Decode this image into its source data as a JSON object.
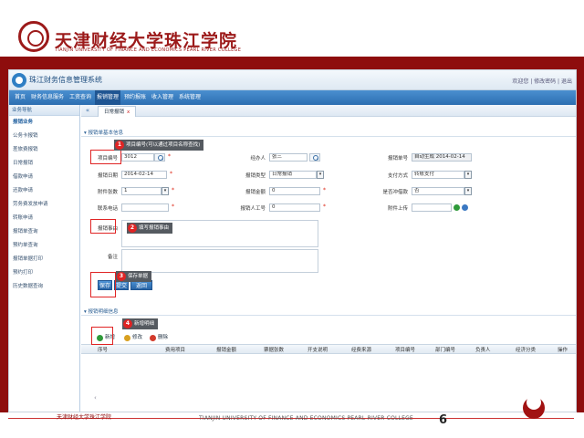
{
  "slide": {
    "university_name_cn": "天津财经大学珠江学院",
    "university_name_en": "TIANJIN UNIVERSITY OF FINANCE AND ECONOMICS PEARL RIVER COLLEGE",
    "footer_left": "天津财经大学珠江学院",
    "footer_center": "TIANJIN UNIVERSITY OF FINANCE AND ECONOMICS PEARL RIVER COLLEGE",
    "page_number": "6",
    "accent_color": "#8e0d0d"
  },
  "app": {
    "title": "珠江财务信息管理系统",
    "top_right": "欢迎您 | 修改密码 | 退出",
    "nav_tabs": [
      "首页",
      "财务信息服务",
      "工资查询",
      "报销管理",
      "预约报账",
      "收入管理",
      "系统管理"
    ],
    "active_tab_index": 3,
    "sidebar_header": "业务导航",
    "sidebar_items": [
      {
        "label": "报销业务",
        "category": true
      },
      {
        "label": "公务卡报销",
        "category": false
      },
      {
        "label": "差旅费报销",
        "category": false
      },
      {
        "label": "日常报销",
        "category": false
      },
      {
        "label": "借款申请",
        "category": false
      },
      {
        "label": "还款申请",
        "category": false
      },
      {
        "label": "劳务费发放申请",
        "category": false
      },
      {
        "label": "转账申请",
        "category": false
      },
      {
        "label": "报销单查询",
        "category": false
      },
      {
        "label": "预约单查询",
        "category": false
      },
      {
        "label": "报销单据打印",
        "category": false
      },
      {
        "label": "预约打印",
        "category": false
      },
      {
        "label": "历史数据查询",
        "category": false
      }
    ],
    "breadcrumb_tab": "日常报销",
    "breadcrumb_close": "x",
    "form_section_title": "报销单基本信息",
    "form": {
      "row1": {
        "label1": "项目编号",
        "value1": "3012",
        "label2": "经办人",
        "value2": "张三",
        "label3": "报销单号",
        "value3": "自动生成 2014-02-14"
      },
      "row2": {
        "label1": "报销日期",
        "value1": "2014-02-14",
        "label2": "报销类型",
        "value2": "日常报销",
        "label3": "支付方式",
        "value3": "转账支付"
      },
      "row3": {
        "label1": "附件张数",
        "value1": "1",
        "label2": "报销金额",
        "value2": "0",
        "label3": "是否冲借款",
        "value3": "否"
      },
      "row4": {
        "label1": "联系电话",
        "value1": "",
        "label2": "报销人工号",
        "value2": "0",
        "label3": "附件上传",
        "value3": ""
      },
      "reason_label": "报销事由",
      "remark_label": "备注"
    },
    "buttons": {
      "save": "保存",
      "submit": "提交",
      "back": "返回"
    },
    "detail_section_title": "报销明细信息",
    "toolbar": {
      "add": "新增",
      "edit": "修改",
      "delete": "删除"
    },
    "grid_columns": [
      "序号",
      "费用项目",
      "报销金额",
      "票据张数",
      "开支说明",
      "经费来源",
      "项目编号",
      "部门编号",
      "负责人",
      "经济分类",
      "操作"
    ]
  },
  "annotations": [
    {
      "num": "1",
      "text": "项目编号(可以通过项目名称查找)"
    },
    {
      "num": "2",
      "text": "填写报销事由"
    },
    {
      "num": "3",
      "text": "保存单据"
    },
    {
      "num": "4",
      "text": "新增明细"
    }
  ]
}
